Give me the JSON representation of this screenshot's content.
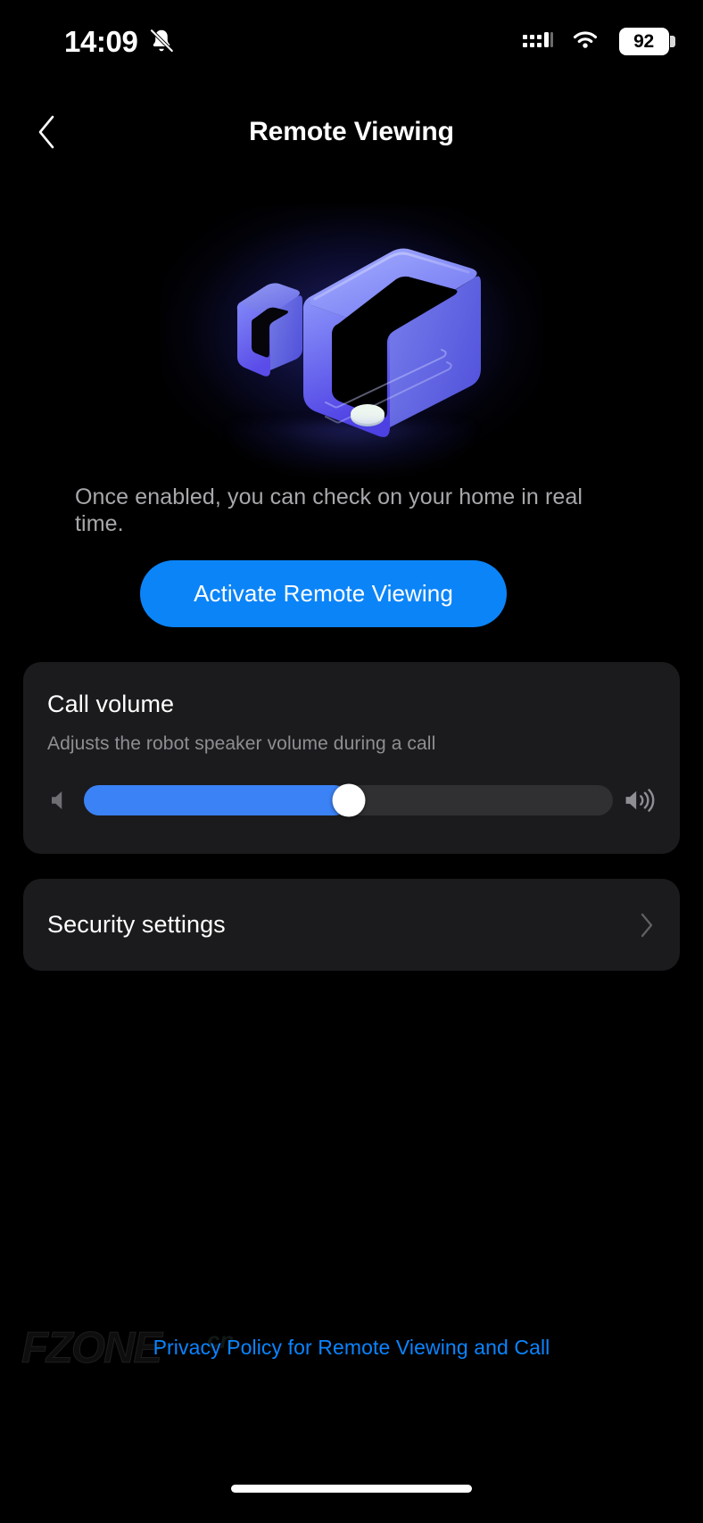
{
  "status_bar": {
    "clock": "14:09",
    "notification_icon": "bell-muted-icon",
    "signal_icon": "signal-bars-icon",
    "signal_bars_filled": 4,
    "wifi_icon": "wifi-icon",
    "battery_icon": "battery-icon",
    "battery_level": "92"
  },
  "header": {
    "back_icon": "chevron-left-icon",
    "title": "Remote Viewing"
  },
  "hero": {
    "illustration_name": "video-camera-3d-illustration",
    "colors": {
      "body_light": "#8a92f6",
      "body_mid": "#6a6bf0",
      "body_deep": "#4b3fe0",
      "glow": "#484bEB",
      "button": "#dfe9e3"
    }
  },
  "description": {
    "text": "Once enabled, you can check on your home in real time."
  },
  "cta": {
    "label": "Activate Remote Viewing",
    "color": "#0b84f8",
    "text_color": "#ffffff"
  },
  "volume_card": {
    "title": "Call volume",
    "subtitle": "Adjusts the robot speaker volume during a call",
    "min_icon": "speaker-low-icon",
    "max_icon": "speaker-high-icon",
    "value_percent": "50",
    "fill_color": "#3b82f6",
    "track_color": "#303032",
    "thumb_color": "#ffffff"
  },
  "security_card": {
    "label": "Security settings",
    "chevron_icon": "chevron-right-icon"
  },
  "watermark": {
    "text": "FZONE",
    "sub_text": "cn"
  },
  "footer": {
    "link_text": "Privacy Policy for Remote Viewing and Call",
    "link_color": "#0a84ff"
  },
  "home_indicator": {
    "name": "home-indicator-bar"
  }
}
